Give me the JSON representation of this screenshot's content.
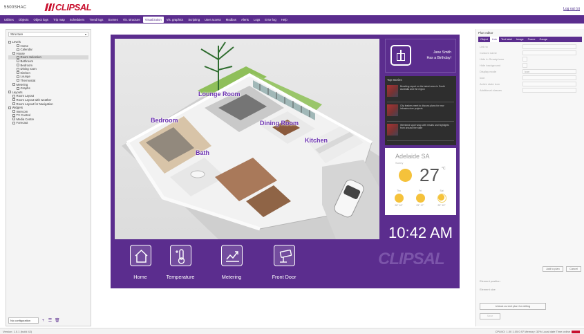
{
  "header": {
    "product": "5500SHAC",
    "logo_text": "CLIPSAL",
    "logout": "Log out (x)"
  },
  "nav": {
    "tabs": [
      "Utilities",
      "Objects",
      "Object logs",
      "Trip map",
      "Schedulers",
      "Trend logs",
      "Scenes",
      "Vis. structure",
      "Visualization",
      "Vis. graphics",
      "Scripting",
      "User access",
      "Modbus",
      "Alerts",
      "Logs",
      "Error log",
      "Help"
    ],
    "active_index": 8
  },
  "tree": {
    "select_label": "Structure",
    "rows": [
      {
        "label": "Levels",
        "indent": 0,
        "folder": true
      },
      {
        "label": "Home",
        "indent": 2,
        "folder": false
      },
      {
        "label": "Calendar",
        "indent": 2,
        "folder": false
      },
      {
        "label": "House",
        "indent": 1,
        "folder": true
      },
      {
        "label": "Room Selection",
        "indent": 2,
        "folder": false,
        "selected": true
      },
      {
        "label": "Bathroom",
        "indent": 2,
        "folder": false
      },
      {
        "label": "Bedroom",
        "indent": 2,
        "folder": false
      },
      {
        "label": "Dining room",
        "indent": 2,
        "folder": false
      },
      {
        "label": "Kitchen",
        "indent": 2,
        "folder": false
      },
      {
        "label": "Lounge",
        "indent": 2,
        "folder": false
      },
      {
        "label": "Thermostat",
        "indent": 2,
        "folder": false
      },
      {
        "label": "Metering",
        "indent": 1,
        "folder": true
      },
      {
        "label": "Graphs",
        "indent": 2,
        "folder": false
      },
      {
        "label": "Layouts",
        "indent": 0,
        "folder": true
      },
      {
        "label": "Room Layout",
        "indent": 1,
        "folder": false
      },
      {
        "label": "Room Layout with weather",
        "indent": 1,
        "folder": false
      },
      {
        "label": "Room Layout for Navigation",
        "indent": 1,
        "folder": false
      },
      {
        "label": "Widgets",
        "indent": 0,
        "folder": true
      },
      {
        "label": "Intercom",
        "indent": 1,
        "folder": false
      },
      {
        "label": "TV Control",
        "indent": 1,
        "folder": false
      },
      {
        "label": "Media Centre",
        "indent": 1,
        "folder": false
      },
      {
        "label": "Forecast",
        "indent": 1,
        "folder": false
      }
    ],
    "bottom_select": "No configuration",
    "bottom_icons": [
      "+",
      "☰",
      "🗑"
    ]
  },
  "house": {
    "rooms": [
      "Lounge Room",
      "Bedroom",
      "Dining Room",
      "Kitchen",
      "Bath"
    ]
  },
  "birthday": {
    "name": "Jane Smith",
    "message": "Has a Birthday!"
  },
  "news": {
    "header": "Top Stories",
    "items": [
      "Breaking report on the latest news in South Australia and the region",
      "City leaders meet to discuss plans for new infrastructure projects",
      "Weekend sport wrap with results and highlights from around the state"
    ]
  },
  "weather": {
    "city": "Adelaide SA",
    "condition": "Sunny",
    "temp": "27",
    "deg": "°C",
    "forecast": [
      {
        "day": "Thu",
        "temp": "28° 16°"
      },
      {
        "day": "Fri",
        "temp": "29° 17°"
      },
      {
        "day": "Sat",
        "temp": "25° 15°"
      }
    ]
  },
  "clock": "10:42 AM",
  "controls": [
    {
      "label": "Home",
      "icon": "home-icon"
    },
    {
      "label": "Temperature",
      "icon": "thermometer-icon"
    },
    {
      "label": "Metering",
      "icon": "chart-icon"
    },
    {
      "label": "Front Door",
      "icon": "security-camera-icon"
    }
  ],
  "watermark": "CLIPSAL",
  "right": {
    "title": "Plan editor",
    "tabs": [
      "Object",
      "Link",
      "Text label",
      "Image",
      "Frame",
      "Gauge"
    ],
    "active_tab": 1,
    "props": [
      {
        "label": "Link to",
        "value": ""
      },
      {
        "label": "Custom name",
        "value": ""
      },
      {
        "label": "Hide in Smartphone",
        "value": ""
      },
      {
        "label": "Hide background",
        "value": ""
      },
      {
        "label": "Display mode",
        "value": "Icon"
      },
      {
        "label": "Icon",
        "value": ""
      },
      {
        "label": "Active state icon",
        "value": ""
      },
      {
        "label": "Additional classes",
        "value": ""
      }
    ],
    "add_button": "Add to plan",
    "cancel_button": "Cancel",
    "position_label": "Element position",
    "size_label": "Element size",
    "unlock_button": "Unlock current plan for editing",
    "save_button": "Save"
  },
  "footer": {
    "left": "Version: 1.0.1 (build 42)",
    "right": "CPU/IO: 1.00 1.05 0.97  Memory: 32%  Local date  Time online"
  }
}
